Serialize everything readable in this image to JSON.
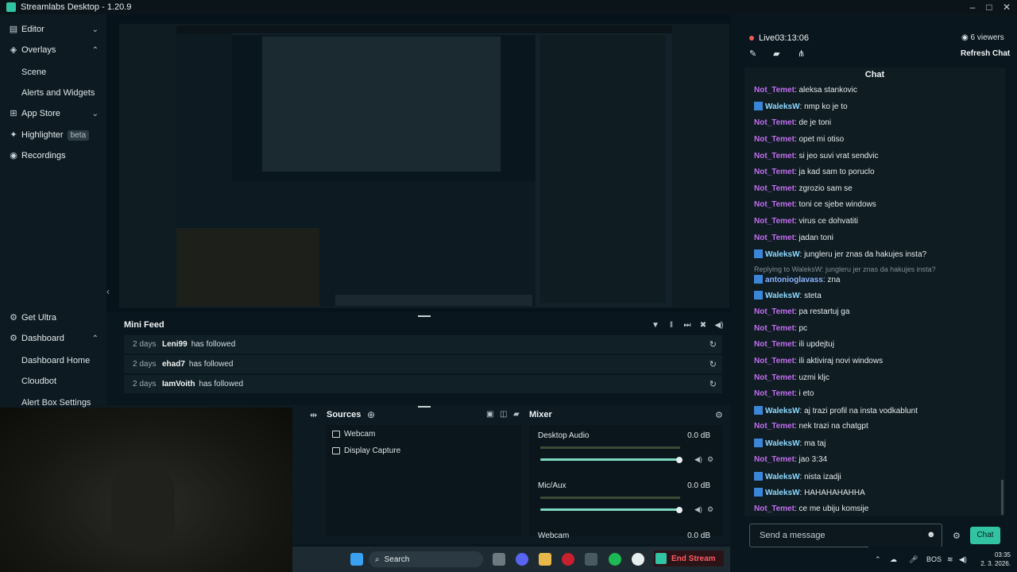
{
  "app": {
    "title": "Streamlabs Desktop - 1.20.9"
  },
  "sidebar": {
    "items": [
      {
        "label": "Editor"
      },
      {
        "label": "Overlays"
      },
      {
        "label": "Scene"
      },
      {
        "label": "Alerts and Widgets"
      },
      {
        "label": "App Store"
      },
      {
        "label": "Highlighter",
        "badge": "beta"
      },
      {
        "label": "Recordings"
      },
      {
        "label": "Get Ultra"
      },
      {
        "label": "Dashboard"
      },
      {
        "label": "Dashboard Home"
      },
      {
        "label": "Cloudbot"
      },
      {
        "label": "Alert Box Settings"
      }
    ]
  },
  "minifeed": {
    "title": "Mini Feed",
    "rows": [
      {
        "time": "2 days",
        "name": "Leni99",
        "action": "has followed"
      },
      {
        "time": "2 days",
        "name": "ehad7",
        "action": "has followed"
      },
      {
        "time": "2 days",
        "name": "IamVoith",
        "action": "has followed"
      }
    ]
  },
  "sources": {
    "title": "Sources",
    "items": [
      "Webcam",
      "Display Capture"
    ]
  },
  "mixer": {
    "title": "Mixer",
    "channels": [
      {
        "name": "Desktop Audio",
        "db": "0.0 dB",
        "level": 1.0
      },
      {
        "name": "Mic/Aux",
        "db": "0.0 dB",
        "level": 1.0
      },
      {
        "name": "Webcam",
        "db": "0.0 dB",
        "level": 1.0
      }
    ]
  },
  "taskbar": {
    "search": "Search",
    "end_stream": "End Stream",
    "lang": "BOS",
    "time": "03:35",
    "date": "2. 3. 2026."
  },
  "stream": {
    "live_label": "Live",
    "duration": "03:13:06",
    "viewers": "6 viewers",
    "refresh": "Refresh Chat"
  },
  "chat": {
    "title": "Chat",
    "placeholder": "Send a message",
    "send": "Chat",
    "messages": [
      {
        "user": "Not_Temet",
        "text": ": aleksa stankovic",
        "color": "purple"
      },
      {
        "user": "WaleksW",
        "text": ": nmp ko je to",
        "color": "blue"
      },
      {
        "user": "Not_Temet",
        "text": ": de je toni",
        "color": "purple"
      },
      {
        "user": "Not_Temet",
        "text": ": opet mi otiso",
        "color": "purple"
      },
      {
        "user": "Not_Temet",
        "text": ": si jeo suvi vrat sendvic",
        "color": "purple"
      },
      {
        "user": "Not_Temet",
        "text": ": ja kad sam to poruclo",
        "color": "purple"
      },
      {
        "user": "Not_Temet",
        "text": ": zgrozio sam se",
        "color": "purple"
      },
      {
        "user": "Not_Temet",
        "text": ": toni ce sjebe windows",
        "color": "purple"
      },
      {
        "user": "Not_Temet",
        "text": ": virus ce dohvatiti",
        "color": "purple"
      },
      {
        "user": "Not_Temet",
        "text": ": jadan toni",
        "color": "purple"
      },
      {
        "user": "WaleksW",
        "text": ": jungleru jer znas da hakujes insta?",
        "color": "blue"
      },
      {
        "reply": "Replying to WaleksW: jungleru jer znas da hakujes insta?"
      },
      {
        "user": "antonioglavass",
        "text": ": zna",
        "color": "lightblue"
      },
      {
        "user": "WaleksW",
        "text": ": steta",
        "color": "blue"
      },
      {
        "user": "Not_Temet",
        "text": ": pa restartuj ga",
        "color": "purple"
      },
      {
        "user": "Not_Temet",
        "text": ": pc",
        "color": "purple"
      },
      {
        "user": "Not_Temet",
        "text": ": ili updejtuj",
        "color": "purple"
      },
      {
        "user": "Not_Temet",
        "text": ": ili aktiviraj novi windows",
        "color": "purple"
      },
      {
        "user": "Not_Temet",
        "text": ": uzmi kljc",
        "color": "purple"
      },
      {
        "user": "Not_Temet",
        "text": ": i eto",
        "color": "purple"
      },
      {
        "user": "WaleksW",
        "text": ": aj trazi profil na insta vodkablunt",
        "color": "blue"
      },
      {
        "user": "Not_Temet",
        "text": ": nek trazi na chatgpt",
        "color": "purple"
      },
      {
        "user": "WaleksW",
        "text": ": ma taj",
        "color": "blue"
      },
      {
        "user": "Not_Temet",
        "text": ": jao 3:34",
        "color": "purple"
      },
      {
        "user": "WaleksW",
        "text": ": nista izadji",
        "color": "blue"
      },
      {
        "user": "WaleksW",
        "text": ": HAHAHAHAHHA",
        "color": "blue"
      },
      {
        "user": "Not_Temet",
        "text": ": ce me ubiju komsije",
        "color": "purple"
      }
    ]
  }
}
